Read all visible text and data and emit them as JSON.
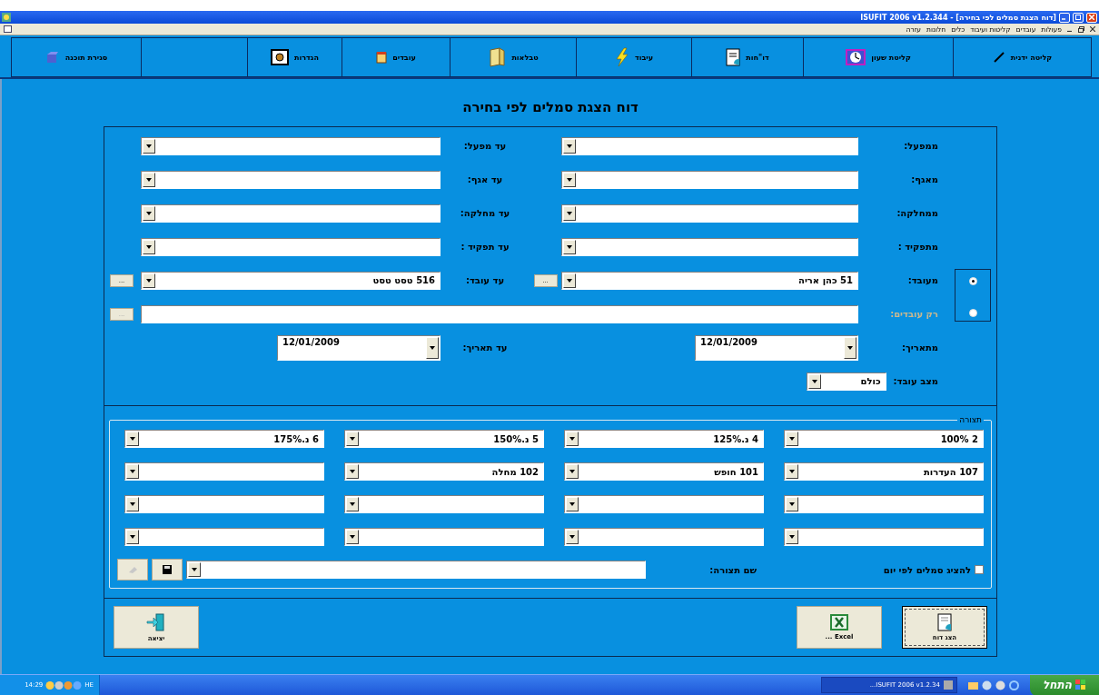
{
  "window": {
    "title": "ISUFIT 2006  v1.2.344 - [דוח הצגת סמלים לפי בחירה]"
  },
  "menu": [
    "פעולות",
    "עובדים",
    "קליטות ועיבוד",
    "כלים",
    "חלונות",
    "עזרה"
  ],
  "toolbar": [
    {
      "label": "קליטה ידנית"
    },
    {
      "label": "קליטת שעון"
    },
    {
      "label": "דו\"חות"
    },
    {
      "label": "עיבוד"
    },
    {
      "label": "טבלאות"
    },
    {
      "label": "עובדים"
    },
    {
      "label": "הגדרות"
    },
    {
      "label": "סגירת תוכנה"
    }
  ],
  "heading": "דוח הצגת סמלים לפי בחירה",
  "range_rows": [
    {
      "from_label": "ממפעל:",
      "to_label": "עד מפעל:"
    },
    {
      "from_label": "מאגף:",
      "to_label": "עד אגף:"
    },
    {
      "from_label": "ממחלקה:",
      "to_label": "עד מחלקה:"
    },
    {
      "from_label": "מתפקיד :",
      "to_label": "עד תפקיד :"
    }
  ],
  "employee_row": {
    "from_label": "מעובד:",
    "from_value": "51 כהן אריה",
    "from_browse": "...",
    "to_label": "עד עובד:",
    "to_value": "516 טסט טסט",
    "to_browse": "..."
  },
  "selection_mode": [
    {
      "selected": true
    },
    {
      "selected": false
    }
  ],
  "only_employees": {
    "label": "רק עובדים:",
    "disabled": true,
    "browse": "..."
  },
  "dates": {
    "from_label": "מתאריך:",
    "from_value": "12/01/2009",
    "to_label": "עד תאריך:",
    "to_value": "12/01/2009"
  },
  "employee_status": {
    "label": "מצב עובד:",
    "value": "כולם"
  },
  "layout_group": {
    "title": "תצורה",
    "symbols": [
      {
        "value": "2 100%"
      },
      {
        "value": "4 נ.125%"
      },
      {
        "value": "5 נ.150%"
      },
      {
        "value": "6 נ.175%"
      },
      {
        "value": "107 העדרות"
      },
      {
        "value": "101 חופש"
      },
      {
        "value": "102 מחלה"
      }
    ],
    "show_by_day": {
      "label": "להציג סמלים לפי יום",
      "checked": false
    },
    "layout_name_label": "שם תצורה:",
    "delete_disabled": true
  },
  "actions": [
    {
      "label": "הצג דוח",
      "focused": true
    },
    {
      "label": "Excel ...",
      "focused": false
    },
    {
      "label": "יציאה",
      "focused": false
    }
  ],
  "taskbar": {
    "start": "התחל",
    "task": "ISUFIT 2006 v1.2.34...",
    "language": "HE",
    "clock": "14:29"
  }
}
